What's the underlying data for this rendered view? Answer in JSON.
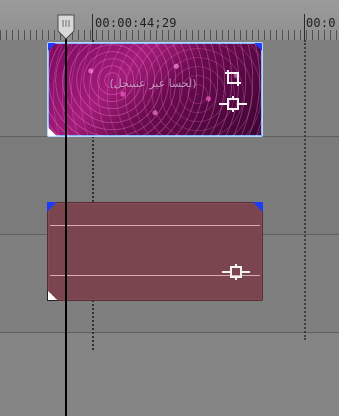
{
  "timeline": {
    "ruler": {
      "timecode_main": "00:00:44;29",
      "timecode_next": "00:0"
    },
    "playhead": {
      "name": "playhead"
    },
    "tracks": {
      "video": {
        "clip": {
          "title_text": "(لحسا عير عنبنحل)",
          "icons": [
            "crop-icon",
            "pan-zoom-icon"
          ]
        }
      },
      "audio": {
        "clip": {
          "icons": [
            "pan-zoom-icon"
          ]
        }
      }
    },
    "colors": {
      "accent_blue": "#1b3cff",
      "video_selected_outline": "#b8d6ff",
      "audio_clip": "#7b4550"
    }
  }
}
